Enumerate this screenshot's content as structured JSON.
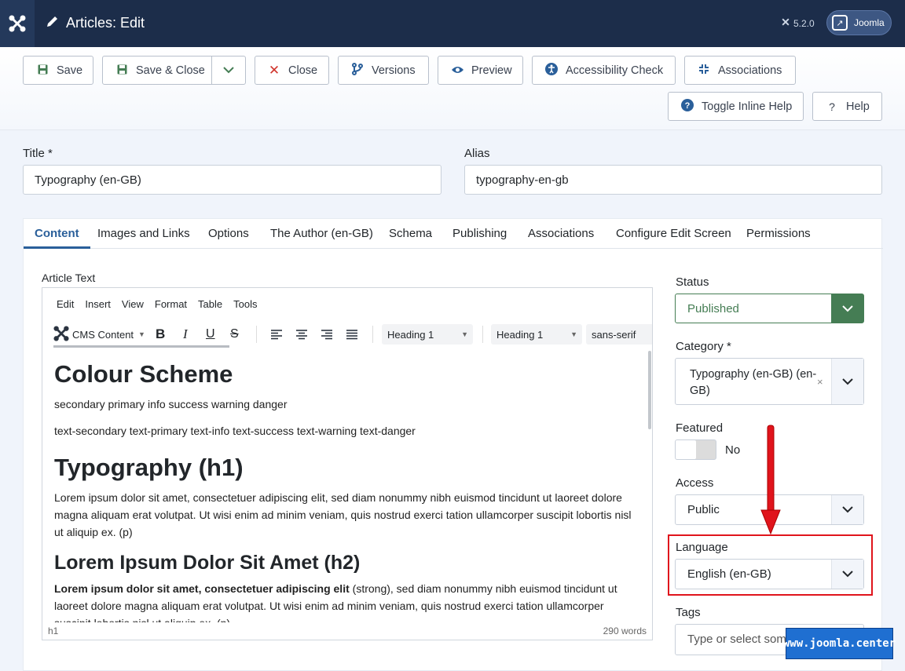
{
  "header": {
    "title": "Articles: Edit",
    "version": "5.2.0",
    "site_button": "Joomla"
  },
  "toolbar": {
    "save": "Save",
    "save_close": "Save & Close",
    "close": "Close",
    "versions": "Versions",
    "preview": "Preview",
    "accessibility": "Accessibility Check",
    "associations": "Associations",
    "inline_help": "Toggle Inline Help",
    "help": "Help"
  },
  "form": {
    "title_label": "Title *",
    "title_value": "Typography (en-GB)",
    "alias_label": "Alias",
    "alias_value": "typography-en-gb"
  },
  "tabs": [
    "Content",
    "Images and Links",
    "Options",
    "The Author (en-GB)",
    "Schema",
    "Publishing",
    "Associations",
    "Configure Edit Screen",
    "Permissions"
  ],
  "editor": {
    "label": "Article Text",
    "menu": [
      "Edit",
      "Insert",
      "View",
      "Format",
      "Table",
      "Tools"
    ],
    "cms_content": "CMS Content",
    "block_format": "Heading 1",
    "style_format": "Heading 1",
    "font_family": "sans-serif",
    "content": {
      "h_colour": "Colour Scheme",
      "p_colours": "secondary primary info success warning danger",
      "p_text_colours": "text-secondary text-primary text-info text-success text-warning text-danger",
      "h1": "Typography (h1)",
      "p_lorem": "Lorem ipsum dolor sit amet, consectetuer adipiscing elit, sed diam nonummy nibh euismod tincidunt ut laoreet dolore magna aliquam erat volutpat. Ut wisi enim ad minim veniam, quis nostrud exerci tation ullamcorper suscipit lobortis nisl ut aliquip ex. (p)",
      "h2": "Lorem Ipsum Dolor Sit Amet (h2)",
      "p_strong": "Lorem ipsum dolor sit amet, consectetuer adipiscing elit",
      "p_strong_rest": " (strong), sed diam nonummy nibh euismod tincidunt ut laoreet dolore magna aliquam erat volutpat. Ut wisi enim ad minim veniam, quis nostrud exerci tation ullamcorper suscipit lobortis nisl ut aliquip ex. (p)"
    },
    "path": "h1",
    "word_count": "290 words"
  },
  "sidebar": {
    "status_label": "Status",
    "status_value": "Published",
    "category_label": "Category *",
    "category_value": "Typography (en-GB) (en-GB)",
    "featured_label": "Featured",
    "featured_value": "No",
    "access_label": "Access",
    "access_value": "Public",
    "language_label": "Language",
    "language_value": "English (en-GB)",
    "tags_label": "Tags",
    "tags_placeholder": "Type or select some"
  },
  "watermark": "www.joomla.center",
  "colors": {
    "header": "#1c2d4a",
    "accent": "#2a5f9a",
    "published": "#457d54",
    "annotation": "#e0141c"
  }
}
